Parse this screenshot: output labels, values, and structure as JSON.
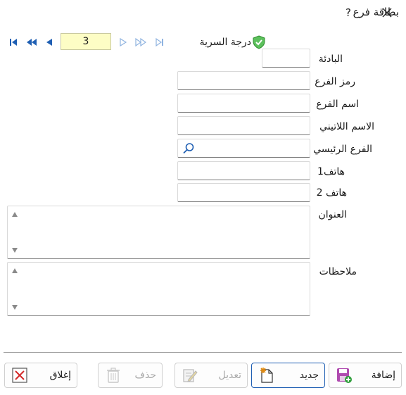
{
  "window": {
    "title": "بطاقة فرع",
    "help_label": "?",
    "close_label": "✕"
  },
  "navigator": {
    "record_number": "3"
  },
  "security": {
    "label": "درجة السرية"
  },
  "form": {
    "prefix_label": "البادئة",
    "branch_code_label": "رمز الفرع",
    "branch_name_label": "اسم الفرع",
    "latin_name_label": "الاسم اللاتيني",
    "main_branch_label": "الفرع الرئيسي",
    "phone1_label": "هاتف1",
    "phone2_label": "هاتف 2",
    "address_label": "العنوان",
    "notes_label": "ملاحظات"
  },
  "buttons": {
    "add": "إضافة",
    "new": "جديد",
    "edit": "تعديل",
    "delete": "حذف",
    "close": "إغلاق"
  }
}
